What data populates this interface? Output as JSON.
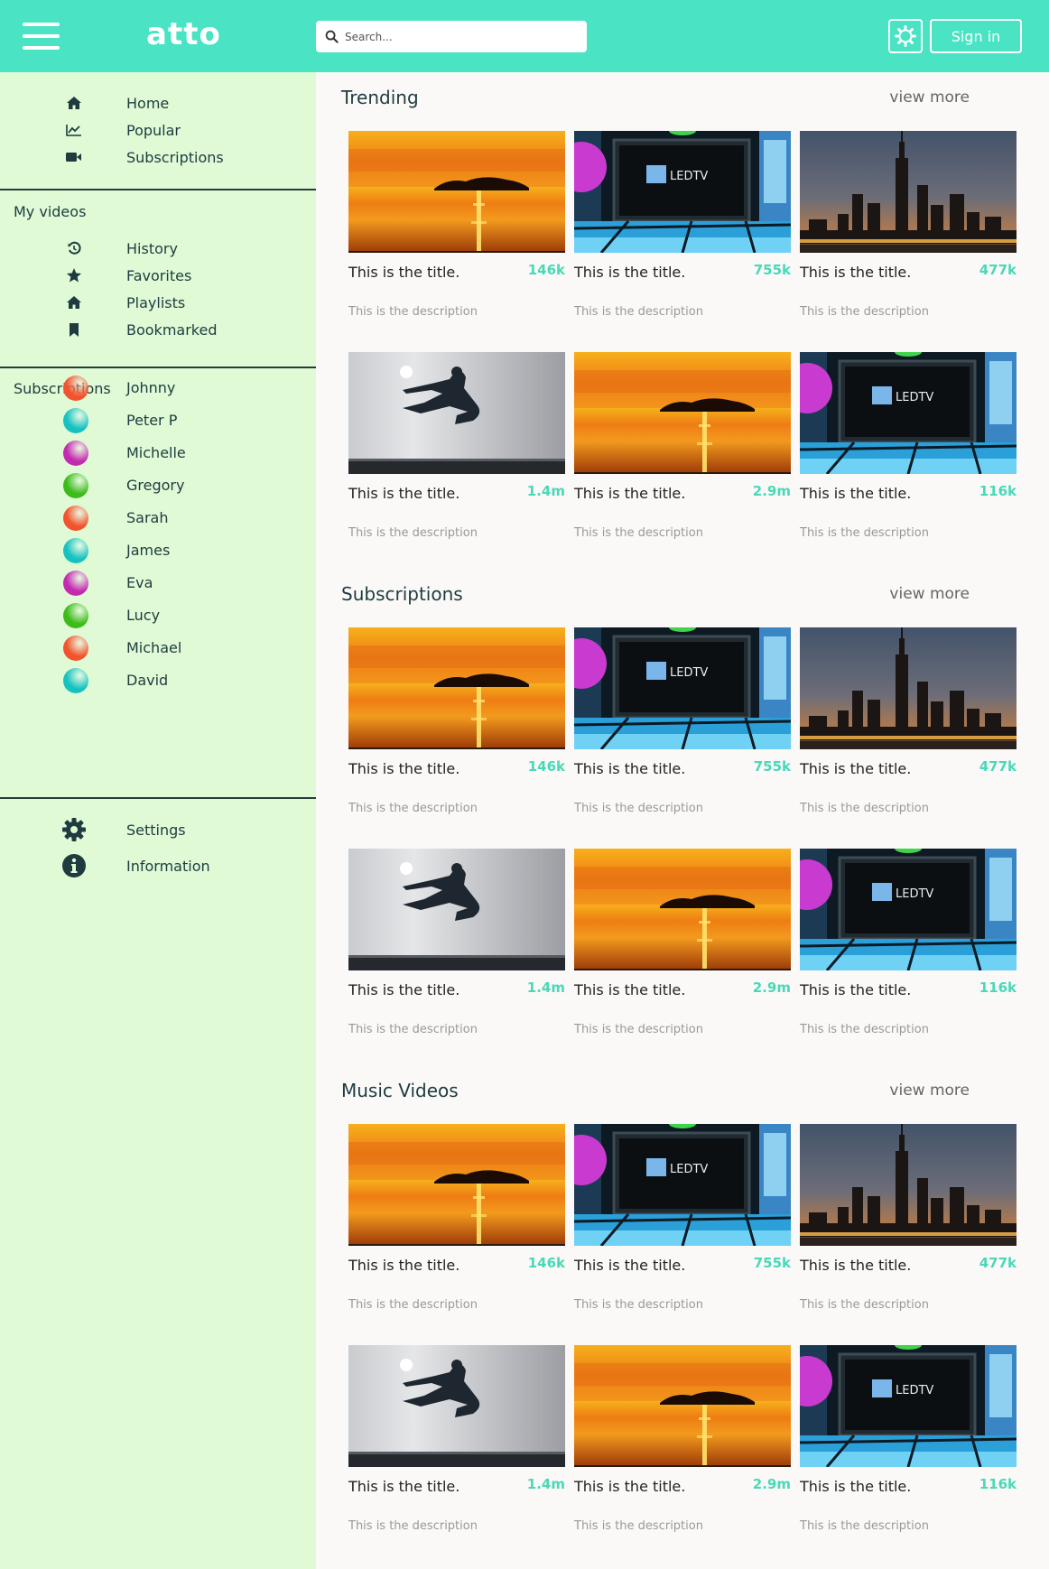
{
  "header": {
    "logo": "atto",
    "search_placeholder": "Search...",
    "sign_in_label": "Sign in"
  },
  "sidebar": {
    "main_items": [
      {
        "label": "Home",
        "icon": "home-icon"
      },
      {
        "label": "Popular",
        "icon": "trending-chart-icon"
      },
      {
        "label": "Subscriptions",
        "icon": "video-camera-icon"
      }
    ],
    "my_videos_title": "My videos",
    "my_videos_items": [
      {
        "label": "History",
        "icon": "history-icon"
      },
      {
        "label": "Favorites",
        "icon": "star-icon"
      },
      {
        "label": "Playlists",
        "icon": "home-icon"
      },
      {
        "label": "Bookmarked",
        "icon": "bookmark-icon"
      }
    ],
    "subscriptions_title": "Subscriptions",
    "subscriptions": [
      {
        "name": "Johnny",
        "color": "#f2532d"
      },
      {
        "name": "Peter P",
        "color": "#16c2c0"
      },
      {
        "name": "Michelle",
        "color": "#c42ab0"
      },
      {
        "name": "Gregory",
        "color": "#3dbb1a"
      },
      {
        "name": "Sarah",
        "color": "#f2532d"
      },
      {
        "name": "James",
        "color": "#16c2c0"
      },
      {
        "name": "Eva",
        "color": "#c42ab0"
      },
      {
        "name": "Lucy",
        "color": "#3dbb1a"
      },
      {
        "name": "Michael",
        "color": "#f2532d"
      },
      {
        "name": "David",
        "color": "#16c2c0"
      }
    ],
    "bottom_items": [
      {
        "label": "Settings",
        "icon": "gear-icon"
      },
      {
        "label": "Information",
        "icon": "info-icon"
      }
    ]
  },
  "sections": [
    {
      "title": "Trending",
      "view_more": "view more",
      "videos": [
        {
          "title": "This is the title.",
          "views": "146k",
          "description": "This is the description",
          "thumb": "sunset"
        },
        {
          "title": "This is the title.",
          "views": "755k",
          "description": "This is the description",
          "thumb": "ledtv"
        },
        {
          "title": "This is the title.",
          "views": "477k",
          "description": "This is the description",
          "thumb": "city"
        },
        {
          "title": "This is the title.",
          "views": "1.4m",
          "description": "This is the description",
          "thumb": "kick"
        },
        {
          "title": "This is the title.",
          "views": "2.9m",
          "description": "This is the description",
          "thumb": "sunset"
        },
        {
          "title": "This is the title.",
          "views": "116k",
          "description": "This is the description",
          "thumb": "ledtv"
        }
      ]
    },
    {
      "title": "Subscriptions",
      "view_more": "view more",
      "videos": [
        {
          "title": "This is the title.",
          "views": "146k",
          "description": "This is the description",
          "thumb": "sunset"
        },
        {
          "title": "This is the title.",
          "views": "755k",
          "description": "This is the description",
          "thumb": "ledtv"
        },
        {
          "title": "This is the title.",
          "views": "477k",
          "description": "This is the description",
          "thumb": "city"
        },
        {
          "title": "This is the title.",
          "views": "1.4m",
          "description": "This is the description",
          "thumb": "kick"
        },
        {
          "title": "This is the title.",
          "views": "2.9m",
          "description": "This is the description",
          "thumb": "sunset"
        },
        {
          "title": "This is the title.",
          "views": "116k",
          "description": "This is the description",
          "thumb": "ledtv"
        }
      ]
    },
    {
      "title": "Music Videos",
      "view_more": "view more",
      "videos": [
        {
          "title": "This is the title.",
          "views": "146k",
          "description": "This is the description",
          "thumb": "sunset"
        },
        {
          "title": "This is the title.",
          "views": "755k",
          "description": "This is the description",
          "thumb": "ledtv"
        },
        {
          "title": "This is the title.",
          "views": "477k",
          "description": "This is the description",
          "thumb": "city"
        },
        {
          "title": "This is the title.",
          "views": "1.4m",
          "description": "This is the description",
          "thumb": "kick"
        },
        {
          "title": "This is the title.",
          "views": "2.9m",
          "description": "This is the description",
          "thumb": "sunset"
        },
        {
          "title": "This is the title.",
          "views": "116k",
          "description": "This is the description",
          "thumb": "ledtv"
        }
      ]
    }
  ],
  "thumb_logo_text": "LEDTV",
  "colors": {
    "accent": "#4ae3c3",
    "sidebar_bg": "#dffad5",
    "views": "#4ad8b8"
  }
}
